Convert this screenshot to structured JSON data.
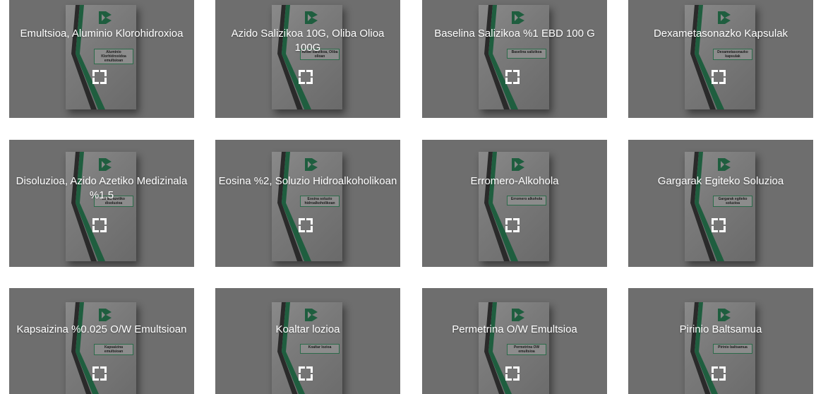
{
  "theme": {
    "card_background": "#6e6e6e",
    "accent_bar_color": "#d9534f",
    "stripe_green": "#1f5e3f",
    "stripe_dark": "#2a2a2a",
    "title_color": "#ffffff"
  },
  "gallery": {
    "items": [
      {
        "title": "Emultsioa, Aluminio Klorohidroxioa",
        "booklet_label": "Aluminio Klorhidroxidoa emultsioan",
        "icon": "expand-icon"
      },
      {
        "title": "Azido Salizikoa 10G, Oliba Olioa 100G",
        "booklet_label": "Azido salizikoa, Oliba olioan",
        "icon": "expand-icon"
      },
      {
        "title": "Baselina Salizikoa %1 EBD 100 G",
        "booklet_label": "Baselina salizikoa",
        "icon": "expand-icon"
      },
      {
        "title": "Dexametasonazko Kapsulak",
        "booklet_label": "Dexametasonazko kapsulak",
        "icon": "expand-icon"
      },
      {
        "title": "Disoluzioa, Azido Azetiko Medizinala %1,5",
        "booklet_label": "Azido azetiko disoluzioa",
        "icon": "expand-icon"
      },
      {
        "title": "Eosina %2, Soluzio Hidroalkoholikoan",
        "booklet_label": "Eosina soluzio hidroalkoholikoan",
        "icon": "expand-icon"
      },
      {
        "title": "Erromero-Alkohola",
        "booklet_label": "Erromero alkohola",
        "icon": "expand-icon"
      },
      {
        "title": "Gargarak Egiteko Soluzioa",
        "booklet_label": "Gargarak egiteko soluzioa",
        "icon": "expand-icon"
      },
      {
        "title": "Kapsaizina %0.025 O/W Emultsioan",
        "booklet_label": "Kapsaizina emultsioan",
        "icon": "expand-icon"
      },
      {
        "title": "Koaltar lozioa",
        "booklet_label": "Koaltar lozioa",
        "icon": "expand-icon"
      },
      {
        "title": "Permetrina O/W Emultsioa",
        "booklet_label": "Permetrina OW emultsioa",
        "icon": "expand-icon"
      },
      {
        "title": "Pirinio Baltsamua",
        "booklet_label": "Pirinio baltsamua",
        "icon": "expand-icon"
      }
    ]
  }
}
